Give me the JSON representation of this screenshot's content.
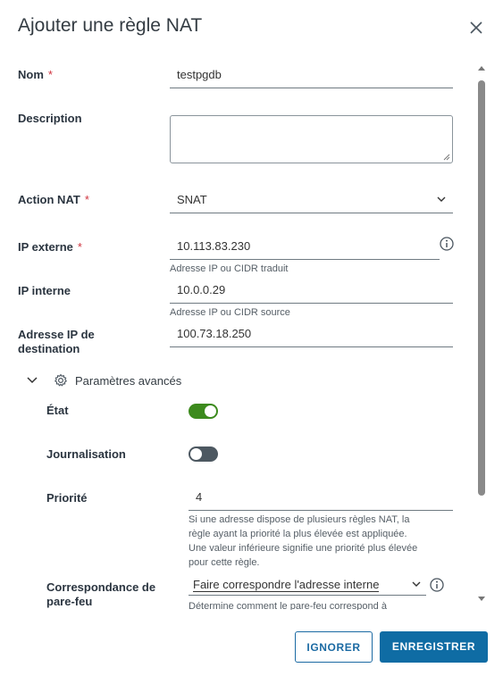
{
  "dialog": {
    "title": "Ajouter une règle NAT",
    "required_mark": "*"
  },
  "form": {
    "name_label": "Nom",
    "name_value": "testpgdb",
    "description_label": "Description",
    "description_value": "",
    "action_label": "Action NAT",
    "action_value": "SNAT",
    "external_ip_label": "IP externe",
    "external_ip_value": "10.113.83.230",
    "external_ip_help": "Adresse IP ou CIDR traduit",
    "internal_ip_label": "IP interne",
    "internal_ip_value": "10.0.0.29",
    "internal_ip_help": "Adresse IP ou CIDR source",
    "dest_ip_label_line1": "Adresse IP de",
    "dest_ip_label_line2": "destination",
    "dest_ip_value": "100.73.18.250"
  },
  "advanced": {
    "section_label": "Paramètres avancés",
    "state_label": "État",
    "state_on": true,
    "logging_label": "Journalisation",
    "logging_on": false,
    "priority_label": "Priorité",
    "priority_value": "4",
    "priority_help": [
      "Si une adresse dispose de plusieurs règles NAT, la",
      "règle ayant la priorité la plus élevée est appliquée.",
      "Une valeur inférieure signifie une priorité plus élevée",
      "pour cette règle."
    ],
    "firewall_label_line1": "Correspondance de",
    "firewall_label_line2": "pare-feu",
    "firewall_value": "Faire correspondre l'adresse interne",
    "firewall_help": "Détermine comment le pare-feu correspond à"
  },
  "buttons": {
    "ignore": "IGNORER",
    "save": "ENREGISTRER"
  },
  "colors": {
    "toggle_on": "#3c8a1d",
    "toggle_off": "#4d5861",
    "primary": "#0f6ca4"
  }
}
